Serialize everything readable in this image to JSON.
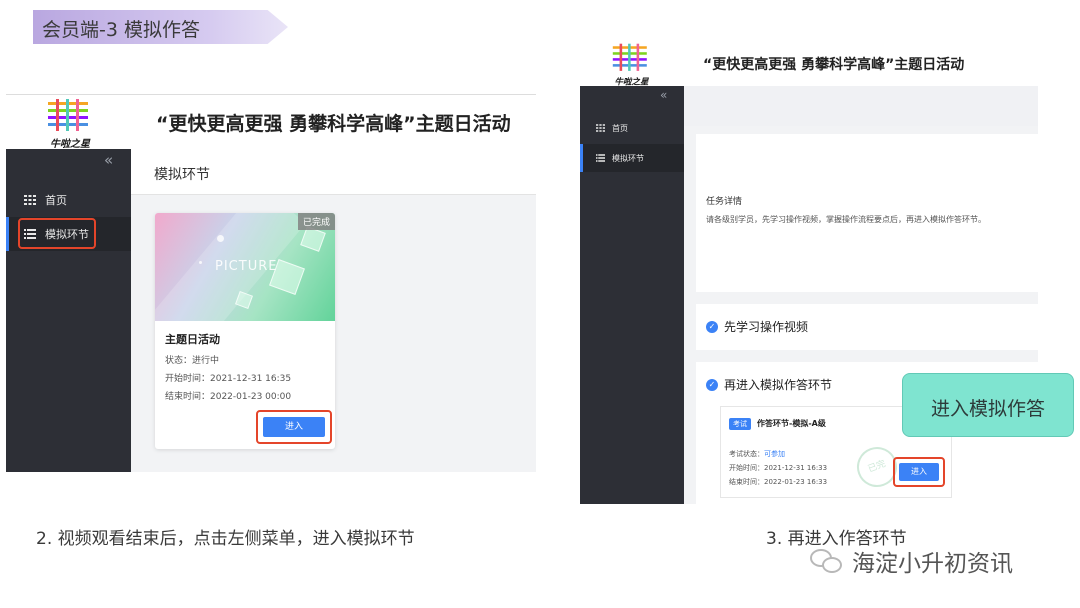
{
  "slide_header": "会员端-3  模拟作答",
  "left_screen": {
    "logo_text": "牛啦之星",
    "title": "“更快更高更强 勇攀科学高峰”主题日活动",
    "sidebar": {
      "collapse_glyph": "«",
      "items": [
        {
          "label": "首页",
          "active": false
        },
        {
          "label": "模拟环节",
          "active": true
        }
      ]
    },
    "section_title": "模拟环节",
    "card": {
      "badge": "已完成",
      "image_text": "PICTURE",
      "title": "主题日活动",
      "status": "状态：进行中",
      "start": "开始时间：2021-12-31 16:35",
      "end": "结束时间：2022-01-23 00:00",
      "enter_label": "进入"
    }
  },
  "right_screen": {
    "logo_text": "牛啦之星",
    "title": "“更快更高更强 勇攀科学高峰”主题日活动",
    "sidebar": {
      "collapse_glyph": "«",
      "items": [
        {
          "label": "首页",
          "active": false
        },
        {
          "label": "模拟环节",
          "active": true
        }
      ]
    },
    "task": {
      "label": "任务详情",
      "text": "请各级别学员，先学习操作视频，掌握操作流程要点后，再进入模拟作答环节。"
    },
    "step1": "先学习操作视频",
    "step2": "再进入模拟作答环节",
    "exam_card": {
      "tag": "考试",
      "title": "作答环节-模拟-A级",
      "status_label": "考试状态：",
      "status_value": "可参加",
      "start": "开始时间：2021-12-31 16:33",
      "end": "结束时间：2022-01-23 16:33",
      "stamp": "已完",
      "enter_label": "进入"
    }
  },
  "callout": "进入模拟作答",
  "caption_left": "2. 视频观看结束后，点击左侧菜单，进入模拟环节",
  "caption_right": "3. 再进入作答环节",
  "watermark": "海淀小升初资讯",
  "colors": {
    "accent": "#3b82f6",
    "sidebar": "#2d2f36",
    "highlight": "#e4452a",
    "callout": "#7fe4d0",
    "header_tag": "#b9a7e0"
  },
  "icons": [
    "logo-icon",
    "grid-icon",
    "list-icon",
    "check-icon",
    "wechat-icon",
    "double-chevron-left-icon"
  ]
}
